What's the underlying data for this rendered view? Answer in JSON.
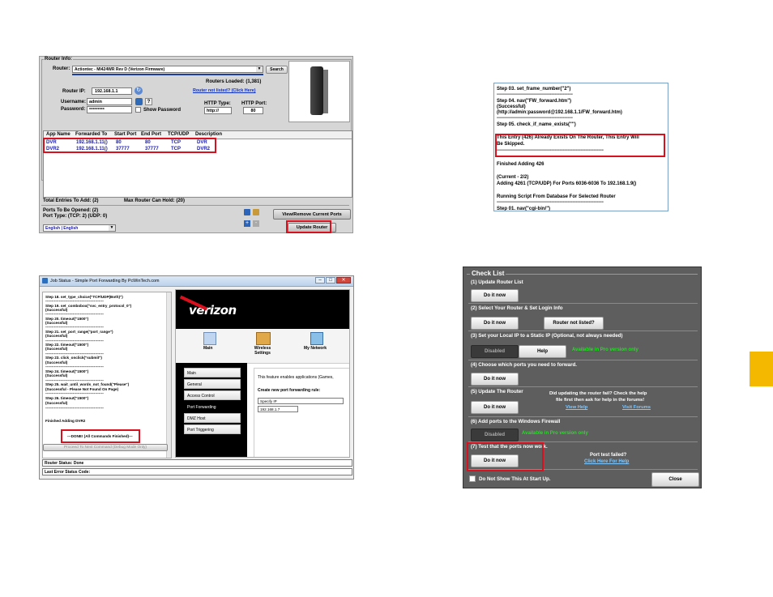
{
  "s1": {
    "group_title": "Router Info:",
    "router_label": "Router:",
    "router_value": "Actiontec - MI424WR Rev D (Verizon Firmware)",
    "search_label": "Search",
    "routers_loaded": "Routers Loaded: (1,381)",
    "router_not_listed": "Router not listed? (Click Here)",
    "router_ip_label": "Router IP:",
    "router_ip_value": "192.168.1.1",
    "username_label": "Username:",
    "username_value": "admin",
    "password_label": "Password:",
    "password_value": "*********",
    "show_password": "Show Password",
    "http_type_label": "HTTP Type:",
    "http_type_value": "http://",
    "http_port_label": "HTTP Port:",
    "http_port_value": "80",
    "help_q": "?",
    "columns": [
      "App Name",
      "Forwarded To",
      "Start Port",
      "End Port",
      "TCP/UDP",
      "Description"
    ],
    "rows": [
      [
        "DVR",
        "192.168.1.11()",
        "80",
        "80",
        "TCP",
        "DVR"
      ],
      [
        "DVR2",
        "192.168.1.11()",
        "37777",
        "37777",
        "TCP",
        "DVR2"
      ]
    ],
    "total_entries": "Total Entries To Add: (2)",
    "max_router": "Max Router Can Hold: (20)",
    "ports_to_open": "Ports To Be Opened: (2)",
    "port_type": "Port Type: (TCP: 2) (UDP: 0)",
    "view_remove": "View/Remove Current Ports",
    "update_router": "Update Router",
    "language": "English | English"
  },
  "s2": {
    "lines": [
      "Step 03. set_frame_number(\"2\")",
      "-----------------------------------------------",
      "Step 04. nav(\"FW_forward.htm\")",
      "(Successful)",
      "(http://admin:password@192.168.1.1/FW_forward.htm)",
      "-----------------------------------------------",
      "Step 05. check_if_name_exists(\"\")",
      "",
      "This Entry (426) Already Exists On The Router, This Entry Will",
      "Be Skipped.",
      "------------------------------------------------------------------",
      "",
      "Finished Adding 426",
      "",
      "(Current - 2/2)",
      "Adding 4261 (TCP/UDP) For Ports 6036-6036 To 192.168.1.9()",
      "",
      "Running Script From Database For Selected Router",
      "------------------------------------------------------------------",
      "Step 01. nav(\"cgi-bin/\")"
    ]
  },
  "s3": {
    "title": "Job Status - Simple Port Forwarding By PcWinTech.com",
    "log": [
      "Step 18. set_type_choice(\"TCP/UDP(Both)\")",
      "-----------------------------------------------",
      "Step 19. set_combobox(\"svc_entry_protocol_0\")",
      "(Successful)",
      "-----------------------------------------------",
      "Step 20. timeout(\"1500\")",
      "(Successful)",
      "-----------------------------------------------",
      "Step 21. set_port_range(\"port_range\")",
      "(Successful)",
      "-----------------------------------------------",
      "Step 22. timeout(\"1500\")",
      "(Successful)",
      "-----------------------------------------------",
      "Step 23. click_onclick(\"submit\")",
      "(Successful)",
      "-----------------------------------------------",
      "Step 24. timeout(\"1500\")",
      "(Successful)",
      "-----------------------------------------------",
      "Step 25. wait_until_words_not_found(\"Please\")",
      "(Successful - Please Not Found On Page)",
      "-----------------------------------------------",
      "Step 26. timeout(\"1500\")",
      "(Successful)",
      "-----------------------------------------------",
      "",
      "Finished Adding DVR2"
    ],
    "done": "---DONE! (All Commands Finished)---",
    "proceed_btn": "Proceed To Next Command (Debug Mode Only)",
    "router_status": "Router Status: Done",
    "last_error": "Last Error Status Code:",
    "brand": "verizon",
    "icons": [
      "Main",
      "Wireless Settings",
      "My Network"
    ],
    "menu": [
      "Main",
      "General",
      "Access Control",
      "Port Forwarding",
      "DMZ Host",
      "Port Triggering"
    ],
    "feature_text": "This feature enables applications (Games,",
    "create_rule": "Create new port forwarding rule:",
    "specify_ip": "Specify IP",
    "ip_value": "192.168.1.7"
  },
  "s4": {
    "title": "Check List",
    "do_it": "Do it now",
    "steps": [
      "(1) Update Router List",
      "(2) Select Your Router & Set Login Info",
      "(3) Set your Local IP to a Static IP (Optional, not always needed)",
      "(4) Choose which ports you need to forward.",
      "(5) Update The Router",
      "(6) Add ports to the Windows Firewall",
      "(7) Test that the ports now work."
    ],
    "router_not_listed": "Router not listed?",
    "disabled": "Disabled",
    "help": "Help",
    "pro_only": "Available in Pro version only",
    "fail_text_1": "Did updating the router fail? Check the help",
    "fail_text_2": "file first then ask for help in the forums!",
    "view_help": "View Help",
    "visit_forums": "Visit Forums",
    "port_test_failed": "Port test failed?",
    "click_here_help": "Click Here For Help",
    "dont_show": "Do Not Show This At Start Up.",
    "close": "Close"
  },
  "colors": {
    "highlight_red": "#d9101e",
    "accent_yellow": "#f5b800"
  }
}
